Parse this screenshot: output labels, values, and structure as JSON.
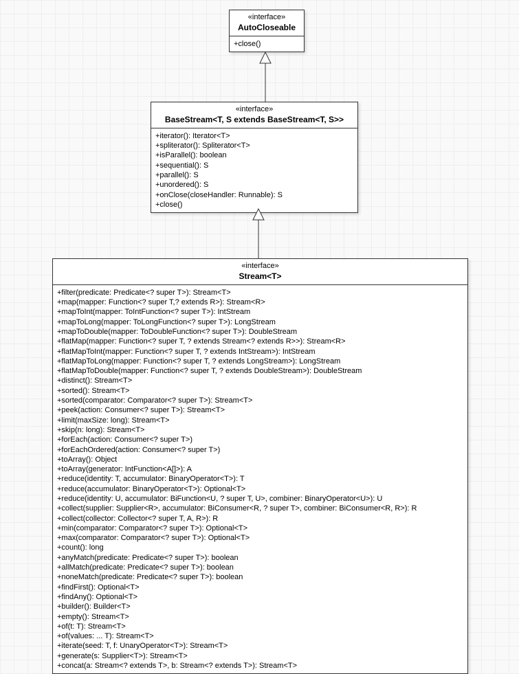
{
  "autoCloseable": {
    "stereo": "«interface»",
    "name": "AutoCloseable",
    "members": [
      "+close()"
    ]
  },
  "baseStream": {
    "stereo": "«interface»",
    "name": "BaseStream<T, S extends BaseStream<T, S>>",
    "members": [
      "+iterator(): Iterator<T>",
      "+spliterator(): Spliterator<T>",
      "+isParallel(): boolean",
      "+sequential(): S",
      "+parallel(): S",
      "+unordered(): S",
      "+onClose(closeHandler: Runnable): S",
      "+close()"
    ]
  },
  "stream": {
    "stereo": "«interface»",
    "name": "Stream<T>",
    "members": [
      "+filter(predicate: Predicate<? super T>): Stream<T>",
      "+map(mapper: Function<? super T,? extends R>): Stream<R>",
      "+mapToInt(mapper: ToIntFunction<? super T>): IntStream",
      "+mapToLong(mapper: ToLongFunction<? super T>): LongStream",
      "+mapToDouble(mapper: ToDoubleFunction<? super T>): DoubleStream",
      "+flatMap(mapper: Function<? super T, ? extends Stream<? extends R>>): Stream<R>",
      "+flatMapToInt(mapper: Function<? super T, ? extends IntStream>): IntStream",
      "+flatMapToLong(mapper: Function<? super T, ? extends LongStream>): LongStream",
      "+flatMapToDouble(mapper: Function<? super T, ? extends DoubleStream>): DoubleStream",
      "+distinct(): Stream<T>",
      "+sorted(): Stream<T>",
      "+sorted(comparator: Comparator<? super T>): Stream<T>",
      "+peek(action: Consumer<? super T>): Stream<T>",
      "+limit(maxSize: long): Stream<T>",
      "+skip(n: long): Stream<T>",
      "+forEach(action: Consumer<? super T>)",
      "+forEachOrdered(action: Consumer<? super T>)",
      "+toArray(): Object",
      "+toArray(generator: IntFunction<A[]>): A",
      "+reduce(identity: T, accumulator: BinaryOperator<T>): T",
      "+reduce(accumulator: BinaryOperator<T>): Optional<T>",
      "+reduce(identity: U, accumulator: BiFunction<U, ? super T, U>, combiner: BinaryOperator<U>): U",
      "+collect(supplier: Supplier<R>, accumulator: BiConsumer<R, ? super T>, combiner: BiConsumer<R, R>): R",
      "+collect(collector: Collector<? super T, A, R>): R",
      "+min(comparator: Comparator<? super T>): Optional<T>",
      "+max(comparator: Comparator<? super T>): Optional<T>",
      "+count(): long",
      "+anyMatch(predicate: Predicate<? super T>): boolean",
      "+allMatch(predicate: Predicate<? super T>): boolean",
      "+noneMatch(predicate: Predicate<? super T>): boolean",
      "+findFirst(): Optional<T>",
      "+findAny(): Optional<T>",
      "+builder(): Builder<T>",
      "+empty(): Stream<T>",
      "+of(t: T): Stream<T>",
      "+of(values: ... T): Stream<T>",
      "+iterate(seed: T, f: UnaryOperator<T>): Stream<T>",
      "+generate(s: Supplier<T>): Stream<T>",
      "+concat(a: Stream<? extends T>, b: Stream<? extends T>): Stream<T>"
    ]
  }
}
